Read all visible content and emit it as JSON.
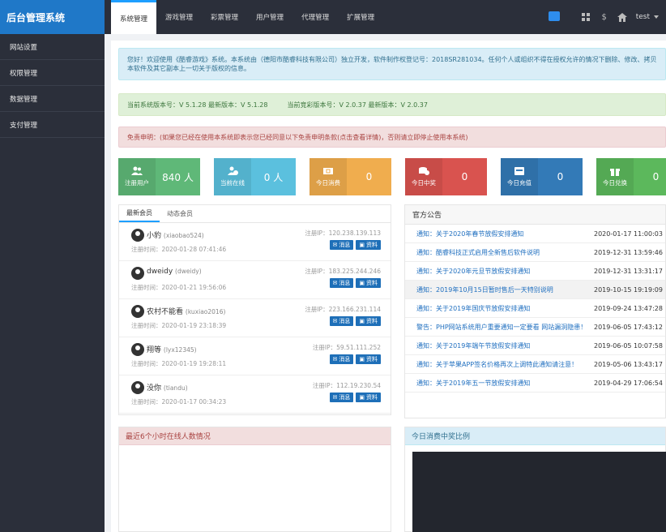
{
  "app_title": "后台管理系统",
  "sidebar": {
    "items": [
      "网站设置",
      "权限管理",
      "数据管理",
      "支付管理"
    ]
  },
  "topnav": {
    "tabs": [
      "系统管理",
      "游戏管理",
      "彩票管理",
      "用户管理",
      "代理管理",
      "扩展管理"
    ],
    "active": 0
  },
  "header": {
    "currency_symbol": "$",
    "user": "test"
  },
  "notices": {
    "welcome": "您好！欢迎使用《酷睿游戏》系统。本系统由（德阳市酷睿科技有限公司）独立开发，软件制作权登记号：2018SR281034。任何个人或组织不得在授权允许的情况下删除、修改、拷贝本软件及其它副本上一切关于版权的信息。",
    "version_system": "当前系统版本号：V 5.1.28  最新版本：V 5.1.28",
    "version_lottery": "当前竞彩版本号：V 2.0.37  最新版本：V 2.0.37",
    "disclaimer": "免责申明：(如果您已经在使用本系统即表示您已经同意以下免责申明条款(点击查看详情)，否则请立即停止使用本系统)"
  },
  "colors": {
    "green": "#5fb878",
    "cyan": "#5bc0de",
    "orange": "#f0ad4e",
    "red": "#d9534f",
    "blue": "#337ab7",
    "lightgreen": "#5cb85c"
  },
  "stats": [
    {
      "label": "注册用户",
      "value": "840 人",
      "color": "#5fb878",
      "icon": "users-icon"
    },
    {
      "label": "当前在线",
      "value": "0 人",
      "color": "#5bc0de",
      "icon": "user-check-icon"
    },
    {
      "label": "今日消费",
      "value": "0",
      "color": "#f0ad4e",
      "icon": "ticket-icon"
    },
    {
      "label": "今日中奖",
      "value": "0",
      "color": "#d9534f",
      "icon": "coins-icon"
    },
    {
      "label": "今日充值",
      "value": "0",
      "color": "#337ab7",
      "icon": "card-icon"
    },
    {
      "label": "今日兑换",
      "value": "0",
      "color": "#5cb85c",
      "icon": "gift-icon"
    }
  ],
  "members": {
    "tabs": [
      "最新会员",
      "动态会员"
    ],
    "rows": [
      {
        "name": "小豹",
        "uid": "(xiaobao524)",
        "time": "注册时间：2020-01-28 07:41:46",
        "ip": "注册IP：120.238.139.113"
      },
      {
        "name": "dweidy",
        "uid": "(dweidy)",
        "time": "注册时间：2020-01-21 19:56:06",
        "ip": "注册IP：183.225.244.246"
      },
      {
        "name": "农村不能看",
        "uid": "(kuxiao2016)",
        "time": "注册时间：2020-01-19 23:18:39",
        "ip": "注册IP：223.166.231.114"
      },
      {
        "name": "翔等",
        "uid": "(lyx12345)",
        "time": "注册时间：2020-01-19 19:28:11",
        "ip": "注册IP：59.51.111.252"
      },
      {
        "name": "没你",
        "uid": "(tiandu)",
        "time": "注册时间：2020-01-17 00:34:23",
        "ip": "注册IP：112.19.230.54"
      }
    ],
    "btn_msg": "消息",
    "btn_info": "资料"
  },
  "announce": {
    "title": "官方公告",
    "rows": [
      {
        "title": "通知：关于2020年春节放假安排通知",
        "date": "2020-01-17 11:00:03"
      },
      {
        "title": "通知：酷睿科技正式启用全新售后软件说明",
        "date": "2019-12-31 13:59:46"
      },
      {
        "title": "通知：关于2020年元旦节放假安排通知",
        "date": "2019-12-31 13:31:17"
      },
      {
        "title": "通知：2019年10月15日暂时售后一天特别说明",
        "date": "2019-10-15 19:19:09"
      },
      {
        "title": "通知：关于2019年国庆节放假安排通知",
        "date": "2019-09-24 13:47:28"
      },
      {
        "title": "警告：PHP网站系统用户重要通知一定要看 网站漏洞隐患！",
        "date": "2019-06-05 17:43:12"
      },
      {
        "title": "通知：关于2019年端午节放假安排通知",
        "date": "2019-06-05 10:07:58"
      },
      {
        "title": "通知：关于苹果APP签名价格再次上调特此通知请注意！",
        "date": "2019-05-06 13:43:17"
      },
      {
        "title": "通知：关于2019年五一节放假安排通知",
        "date": "2019-04-29 17:06:54"
      }
    ],
    "highlight_index": 3
  },
  "panels": {
    "online_title": "最近6个小时在线人数情况",
    "ratio_title": "今日消费中奖比例"
  }
}
